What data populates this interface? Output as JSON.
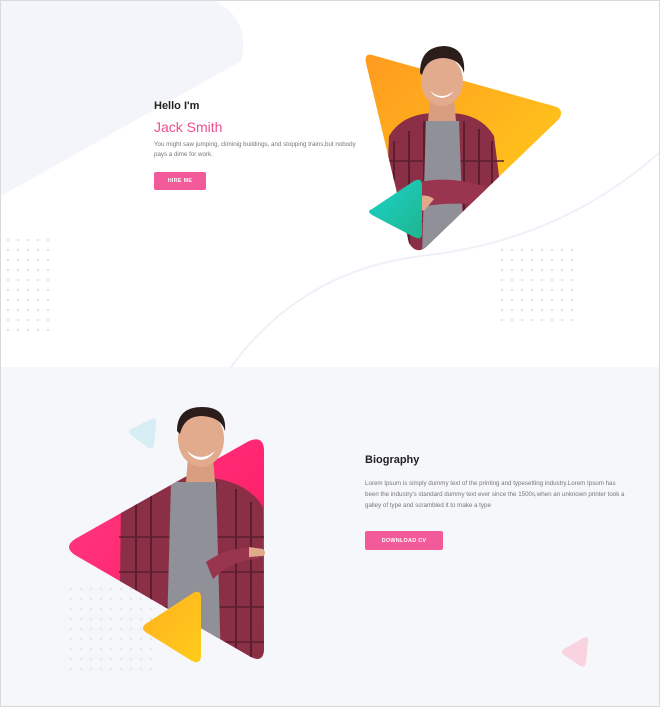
{
  "hero": {
    "greeting": "Hello I'm",
    "name": "Jack Smith",
    "description": "You might saw jumping, climinig buildings, and stopping trains,but nobody pays a dime for work.",
    "hire_button_label": "HIRE ME"
  },
  "biography": {
    "title": "Biography",
    "description": "Lorem Ipsum is simply dummy text of the printing and typesetting industry.Lorem Ipsum has been the industry's standard dummy text ever since the 1500s,when an unknown printer took a galley of type and scrambled it to make a type",
    "download_button_label": "DOWNLOAD CV"
  },
  "colors": {
    "accent_pink": "#f25a9a",
    "name_pink": "#ee4f8e",
    "orange_gradient_start": "#ff9a1f",
    "orange_gradient_end": "#ffd21a",
    "teal_gradient_start": "#1bd3c9",
    "teal_gradient_end": "#1fb58f",
    "pink_gradient_start": "#ff3f83",
    "pink_gradient_end": "#ff0f5f",
    "bio_background": "#f6f7fb"
  },
  "icons": [
    "hero-orange-triangle",
    "hero-teal-triangle",
    "bio-pink-triangle",
    "bio-orange-triangle",
    "decor-dot-grid"
  ]
}
